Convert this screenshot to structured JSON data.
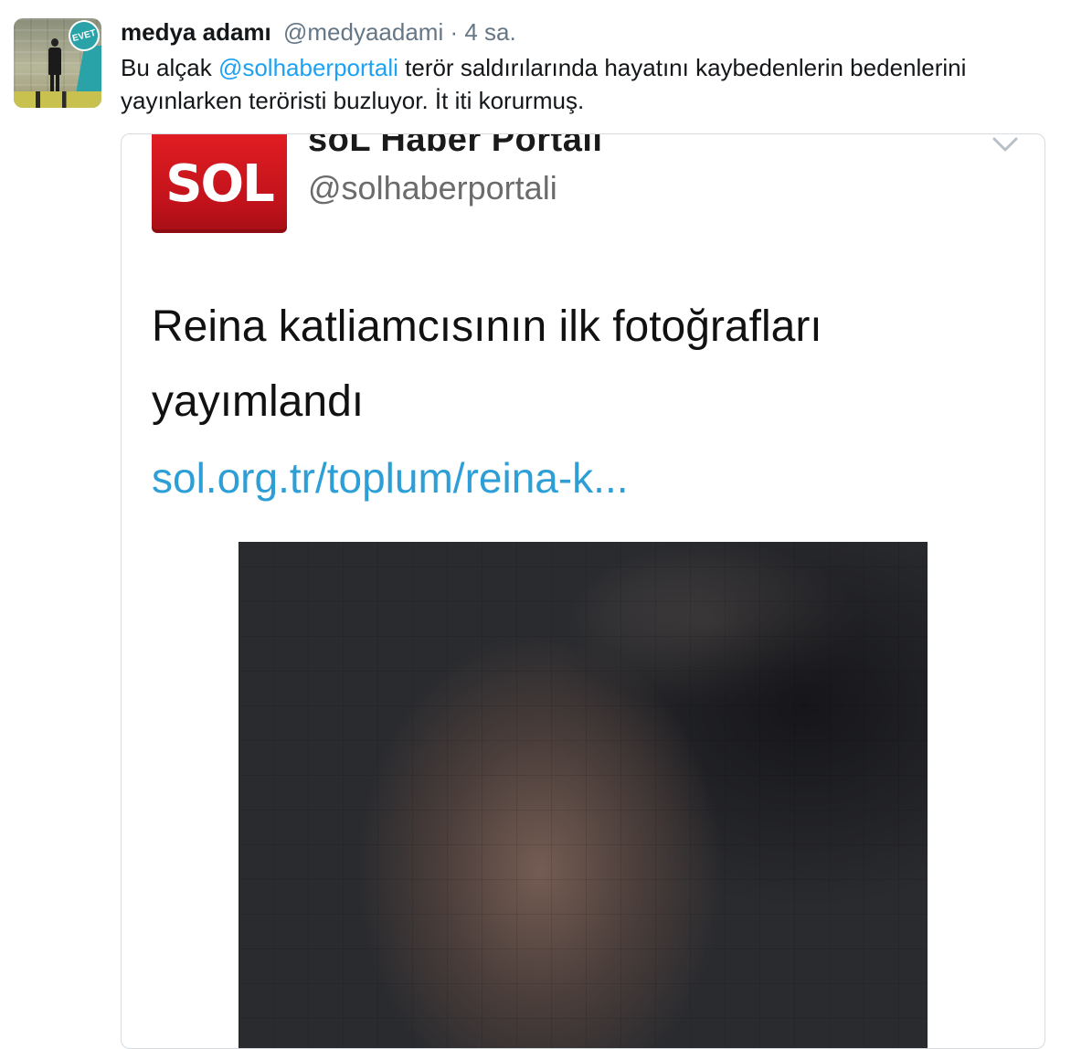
{
  "tweet": {
    "display_name": "medya adamı",
    "username": "@medyaadami",
    "separator": "·",
    "time": "4 sa.",
    "text_before": "Bu alçak ",
    "mention": "@solhaberportali",
    "text_after": " terör saldırılarında hayatını kaybedenlerin bedenlerini yayınlarken teröristi buzluyor. İt iti korurmuş.",
    "avatar": {
      "badge_text": "EVET"
    }
  },
  "quoted": {
    "logo_text": "SOL",
    "name": "soL Haber Portalı",
    "handle": "@solhaberportali",
    "text": "Reina katliamcısının ilk fotoğrafları yayımlandı",
    "link": "sol.org.tr/toplum/reina-k..."
  },
  "colors": {
    "link": "#1da1f2",
    "muted": "#657786",
    "sol_red": "#d0181f"
  },
  "icons": {
    "menu": "chevron-down-icon"
  }
}
